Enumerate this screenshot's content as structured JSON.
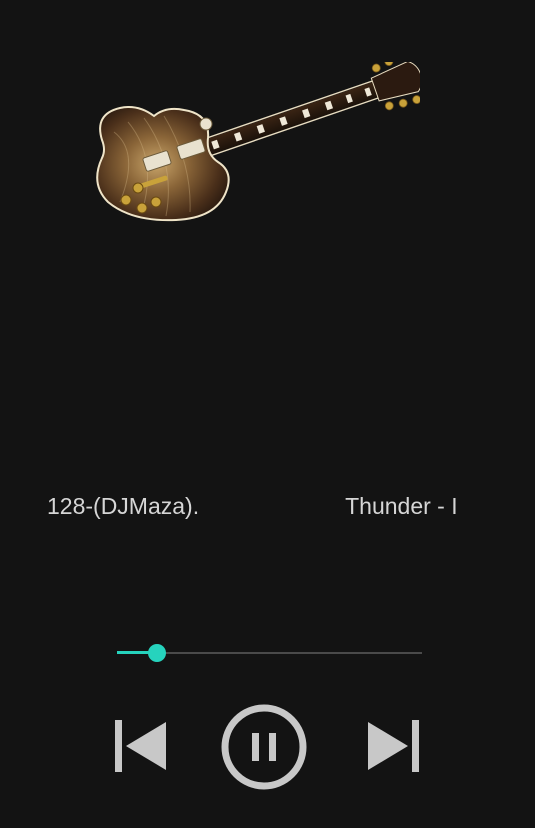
{
  "player": {
    "title_tail": "128-(DJMaza).",
    "title_next": "Thunder - I",
    "progress_fraction": 0.13
  },
  "icons": {
    "album_art": "electric-guitar-image",
    "prev": "skip-previous-icon",
    "play_pause": "pause-circle-icon",
    "next": "skip-next-icon"
  },
  "colors": {
    "background": "#131313",
    "accent": "#26d3bd",
    "control": "#c8c8c8",
    "text": "#d6d6d6"
  }
}
